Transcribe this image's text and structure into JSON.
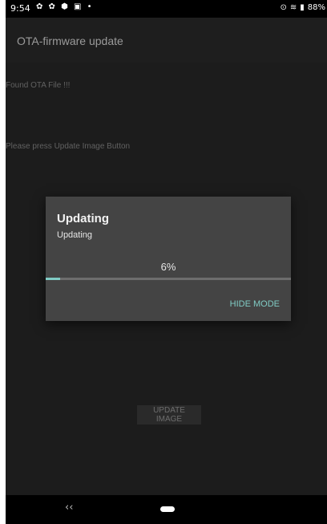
{
  "status_bar": {
    "time": "9:54",
    "notification_icons": "✿ ✿ ⬢ ▣ •",
    "location_icon": "location-icon",
    "wifi_icon": "wifi-icon",
    "battery_icon": "battery-icon",
    "battery": "88%"
  },
  "app_bar": {
    "title": "OTA-firmware update"
  },
  "main": {
    "message1": "Found OTA File !!!",
    "message2": "Please press Update Image Button",
    "update_button": "UPDATE IMAGE"
  },
  "dialog": {
    "title": "Updating",
    "message": "Updating",
    "progress_label": "6%",
    "progress_fraction": 0.06,
    "action": "HIDE MODE",
    "accent_color": "#80cbc4"
  },
  "nav_bar": {
    "back_icon": "back-icon",
    "home_icon": "home-pill-icon"
  }
}
